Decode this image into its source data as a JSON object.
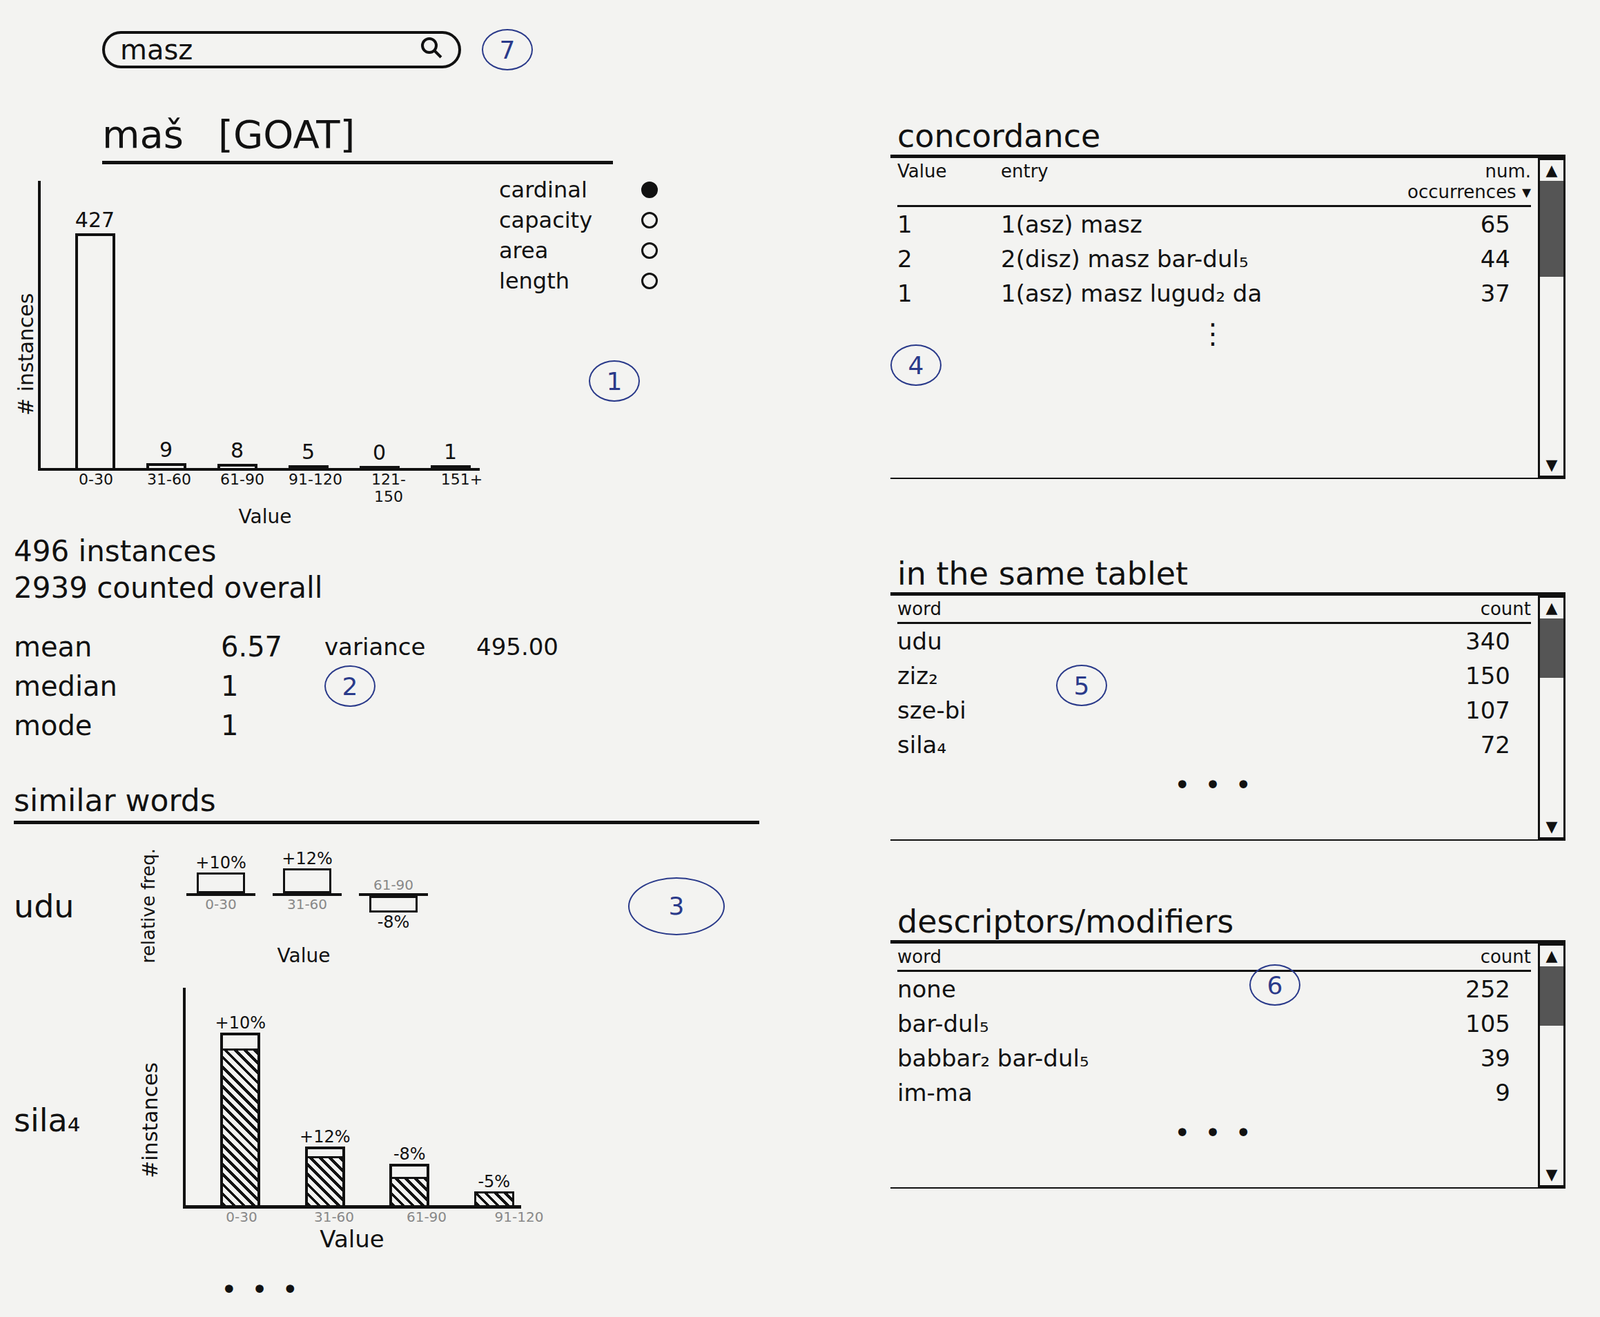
{
  "search": {
    "value": "masz",
    "annotation": "7"
  },
  "word": {
    "title": "maš",
    "gloss": "[GOAT]",
    "annotation": "1",
    "chart": {
      "y_label": "# instances",
      "x_label": "Value",
      "ticks": [
        "0-30",
        "31-60",
        "61-90",
        "91-120",
        "121-150",
        "151+"
      ],
      "values": [
        427,
        9,
        8,
        5,
        0,
        1
      ],
      "labels": [
        "427",
        "9",
        "8",
        "5",
        "0",
        "1"
      ]
    },
    "units": [
      {
        "label": "cardinal",
        "selected": true
      },
      {
        "label": "capacity",
        "selected": false
      },
      {
        "label": "area",
        "selected": false
      },
      {
        "label": "length",
        "selected": false
      }
    ],
    "instances": "496 instances",
    "counted": "2939 counted overall"
  },
  "stats": {
    "annotation": "2",
    "left": [
      {
        "label": "mean",
        "value": "6.57"
      },
      {
        "label": "median",
        "value": "1"
      },
      {
        "label": "mode",
        "value": "1"
      }
    ],
    "right": [
      {
        "label": "variance",
        "value": "495.00"
      }
    ]
  },
  "similar": {
    "title": "similar words",
    "annotation": "3",
    "more": "• • •",
    "words": [
      {
        "word": "udu",
        "kind": "relative",
        "y_label": "relative freq.",
        "x_label": "Value",
        "ticks": [
          "0-30",
          "31-60",
          "61-90"
        ],
        "values": [
          10,
          12,
          -8
        ],
        "labels": [
          "+10%",
          "+12%",
          "-8%"
        ]
      },
      {
        "word": "sila₄",
        "kind": "overlay",
        "y_label": "#instances",
        "x_label": "Value",
        "ticks": [
          "0-30",
          "31-60",
          "61-90",
          "91-120"
        ],
        "expected": [
          440,
          150,
          105,
          0
        ],
        "observed": [
          400,
          125,
          72,
          35
        ],
        "labels": [
          "+10%",
          "+12%",
          "-8%",
          "-5%"
        ]
      }
    ]
  },
  "concordance": {
    "title": "concordance",
    "annotation": "4",
    "columns": [
      "Value",
      "entry",
      "num. occurrences"
    ],
    "sort_icon": "▾",
    "rows": [
      [
        "1",
        "1(asz) masz",
        "65"
      ],
      [
        "2",
        "2(disz) masz bar-dul₅",
        "44"
      ],
      [
        "1",
        "1(asz) masz lugud₂ da",
        "37"
      ]
    ],
    "more": "⋮",
    "scroll": {
      "up": "▲",
      "down": "▼",
      "level": 0.35
    }
  },
  "tablet": {
    "title": "in the same tablet",
    "annotation": "5",
    "columns": [
      "word",
      "count"
    ],
    "rows": [
      [
        "udu",
        "340"
      ],
      [
        "ziz₂",
        "150"
      ],
      [
        "sze-bi",
        "107"
      ],
      [
        "sila₄",
        "72"
      ]
    ],
    "more": "• • •",
    "scroll": {
      "up": "▲",
      "down": "▼",
      "level": 0.3
    }
  },
  "descriptors": {
    "title": "descriptors/modifiers",
    "annotation": "6",
    "columns": [
      "word",
      "count"
    ],
    "rows": [
      [
        "none",
        "252"
      ],
      [
        "bar-dul₅",
        "105"
      ],
      [
        "babbar₂ bar-dul₅",
        "39"
      ],
      [
        "im-ma",
        "9"
      ]
    ],
    "more": "• • •",
    "scroll": {
      "up": "▲",
      "down": "▼",
      "level": 0.3
    }
  }
}
